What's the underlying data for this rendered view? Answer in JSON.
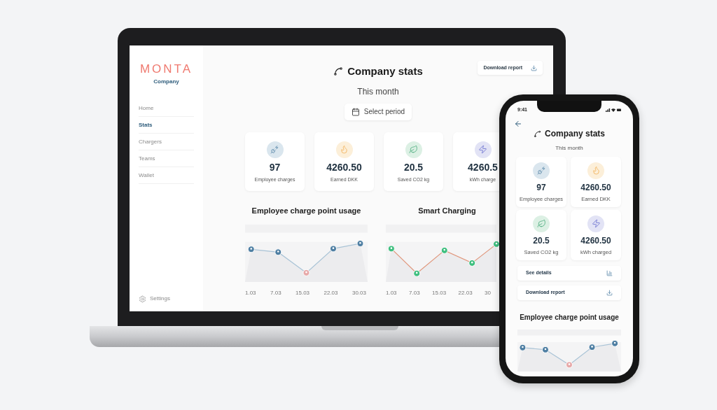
{
  "laptop": {
    "sidebar": {
      "logo": "MONTA",
      "logo_subtitle": "Company",
      "items": [
        {
          "label": "Home",
          "selected": false
        },
        {
          "label": "Stats",
          "selected": true
        },
        {
          "label": "Chargers",
          "selected": false
        },
        {
          "label": "Teams",
          "selected": false
        },
        {
          "label": "Wallet",
          "selected": false
        }
      ],
      "settings": "Settings"
    },
    "header": {
      "title": "Company stats",
      "subtitle": "This month",
      "period_button": "Select period",
      "download_button": "Download report"
    },
    "stats": [
      {
        "kind": "charger",
        "color": "#dae6ee",
        "value": "97",
        "label": "Employee charges"
      },
      {
        "kind": "earnings",
        "color": "#fcefd9",
        "value": "4260.50",
        "label": "Earned DKK"
      },
      {
        "kind": "co2",
        "color": "#dcf0e4",
        "value": "20.5",
        "label": "Saved CO2 kg"
      },
      {
        "kind": "energy",
        "color": "#e2e3f5",
        "value": "4260.5",
        "label": "kWh charge"
      }
    ],
    "charts": [
      {
        "kind": "usage",
        "title": "Employee charge point usage",
        "x_labels": [
          "1.03",
          "7.03",
          "15.03",
          "22.03",
          "30.03"
        ]
      },
      {
        "kind": "smart",
        "title": "Smart Charging",
        "x_labels": [
          "1.03",
          "7.03",
          "15.03",
          "22.03",
          "30"
        ]
      }
    ]
  },
  "phone": {
    "status_time": "9:41",
    "title": "Company stats",
    "subtitle": "This month",
    "stats": [
      {
        "kind": "charger",
        "color": "#dae6ee",
        "value": "97",
        "label": "Employee charges"
      },
      {
        "kind": "earnings",
        "color": "#fcefd9",
        "value": "4260.50",
        "label": "Earned DKK"
      },
      {
        "kind": "co2",
        "color": "#dcf0e4",
        "value": "20.5",
        "label": "Saved CO2 kg"
      },
      {
        "kind": "energy",
        "color": "#e2e3f5",
        "value": "4260.50",
        "label": "kWh charged"
      }
    ],
    "actions": [
      {
        "kind": "details",
        "label": "See details"
      },
      {
        "kind": "download",
        "label": "Download report"
      }
    ],
    "chart": {
      "kind": "usage",
      "title": "Employee charge point usage"
    }
  }
}
